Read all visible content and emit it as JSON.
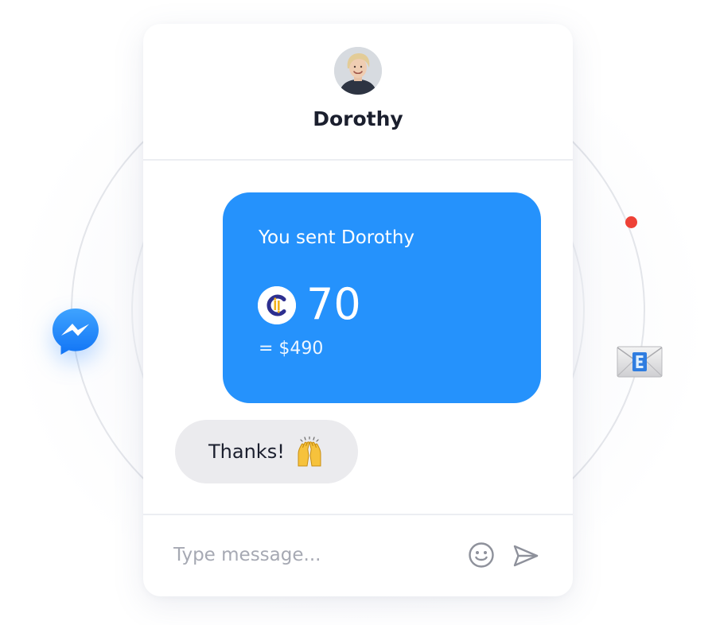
{
  "contact": {
    "name": "Dorothy"
  },
  "sent_message": {
    "title": "You sent Dorothy",
    "coin_letter": "C",
    "amount": "70",
    "fiat_value": "= $490"
  },
  "received_message": {
    "text": "Thanks!",
    "emoji": "raising-hands"
  },
  "composer": {
    "placeholder": "Type message..."
  },
  "icons": {
    "avatar": "avatar-photo",
    "coin": "coin-icon",
    "emoji": "smiley-face-icon",
    "send": "paper-plane-send-icon",
    "messenger": "messenger-icon",
    "email": "envelope-e-icon",
    "notification": "red-dot"
  },
  "colors": {
    "bubble_blue": "#2592fc",
    "received_gray": "#ebebee",
    "messenger_blue": "#1f82ff",
    "notification_red": "#ee4136",
    "name_text": "#1b1f2e"
  }
}
